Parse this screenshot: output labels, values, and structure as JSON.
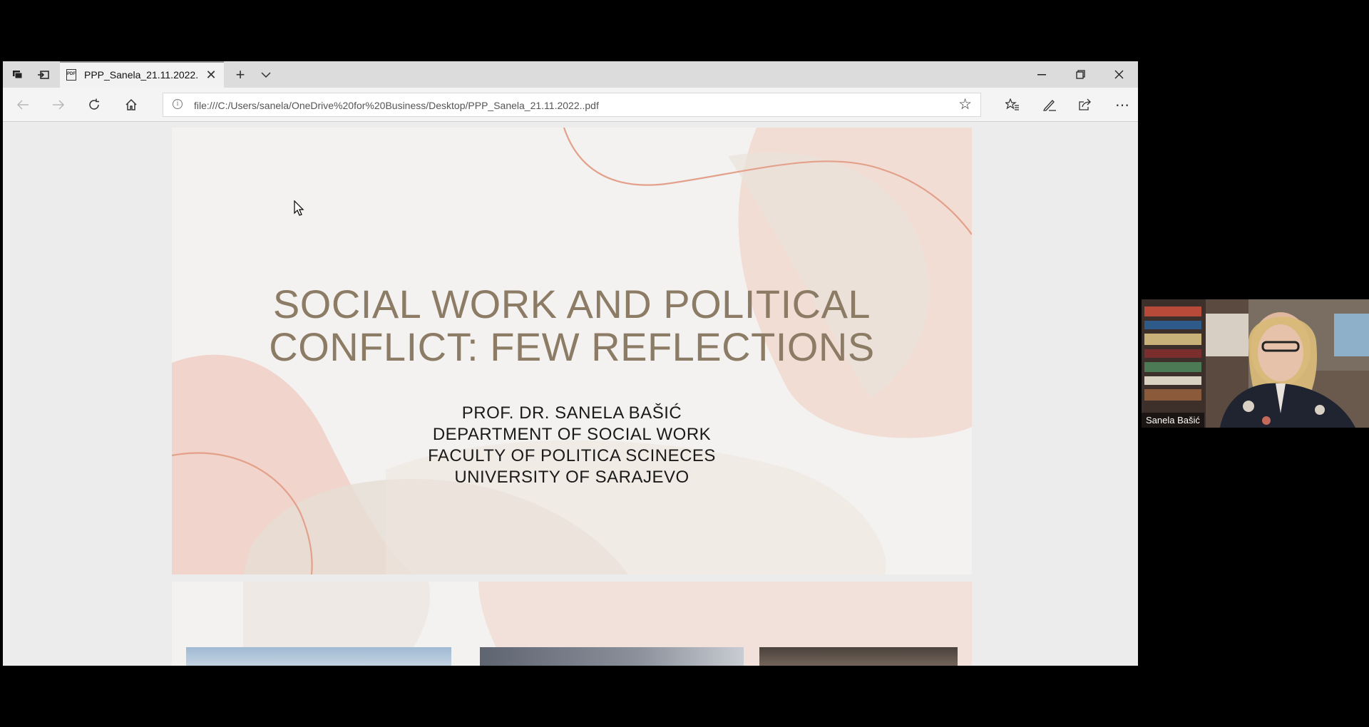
{
  "browser": {
    "tab": {
      "title": "PPP_Sanela_21.11.2022.",
      "favicon": "pdf-icon"
    },
    "address_bar": {
      "url": "file:///C:/Users/sanela/OneDrive%20for%20Business/Desktop/PPP_Sanela_21.11.2022..pdf"
    },
    "icons": [
      "tab-manager-icon",
      "set-aside-tabs-icon",
      "close-icon",
      "plus-icon",
      "chevron-down-icon",
      "minimize-icon",
      "restore-icon",
      "back-icon",
      "forward-icon",
      "refresh-icon",
      "home-icon",
      "info-icon",
      "star-icon",
      "favorites-icon",
      "pen-icon",
      "share-icon",
      "more-icon"
    ]
  },
  "slide": {
    "title_line1": "SOCIAL WORK AND POLITICAL",
    "title_line2": "CONFLICT: FEW REFLECTIONS",
    "author": "PROF. DR. SANELA BAŠIĆ",
    "department": "DEPARTMENT OF SOCIAL WORK",
    "faculty": "FACULTY OF POLITICA SCINECES",
    "university": "UNIVERSITY OF SARAJEVO",
    "colors": {
      "title": "#8c7b65",
      "accent_line": "#e3a08a",
      "blob": "#f2d2c6"
    }
  },
  "video": {
    "participant_name": "Sanela Bašić"
  }
}
